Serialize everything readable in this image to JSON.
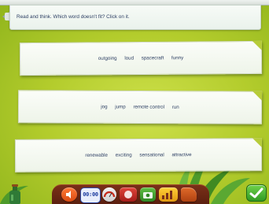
{
  "instruction": {
    "text": "Read and think. Which word doesn't fit? Click on it."
  },
  "cards": [
    {
      "words": [
        "outgoing",
        "loud",
        "spacecraft",
        "funny"
      ]
    },
    {
      "words": [
        "jog",
        "jump",
        "remote control",
        "run"
      ]
    },
    {
      "words": [
        "renewable",
        "exciting",
        "sensational",
        "attractive"
      ]
    }
  ],
  "toolbar": {
    "clock_text": "00:00",
    "icons": [
      "speaker-icon",
      "clock-icon",
      "gauge-icon",
      "stop-icon",
      "camera-icon",
      "levels-icon",
      "menu-icon"
    ]
  },
  "colors": {
    "background": "#b3cc2c",
    "text": "#2c3e63",
    "toolbar": "#6a2614",
    "ok_button": "#3fae2e"
  }
}
